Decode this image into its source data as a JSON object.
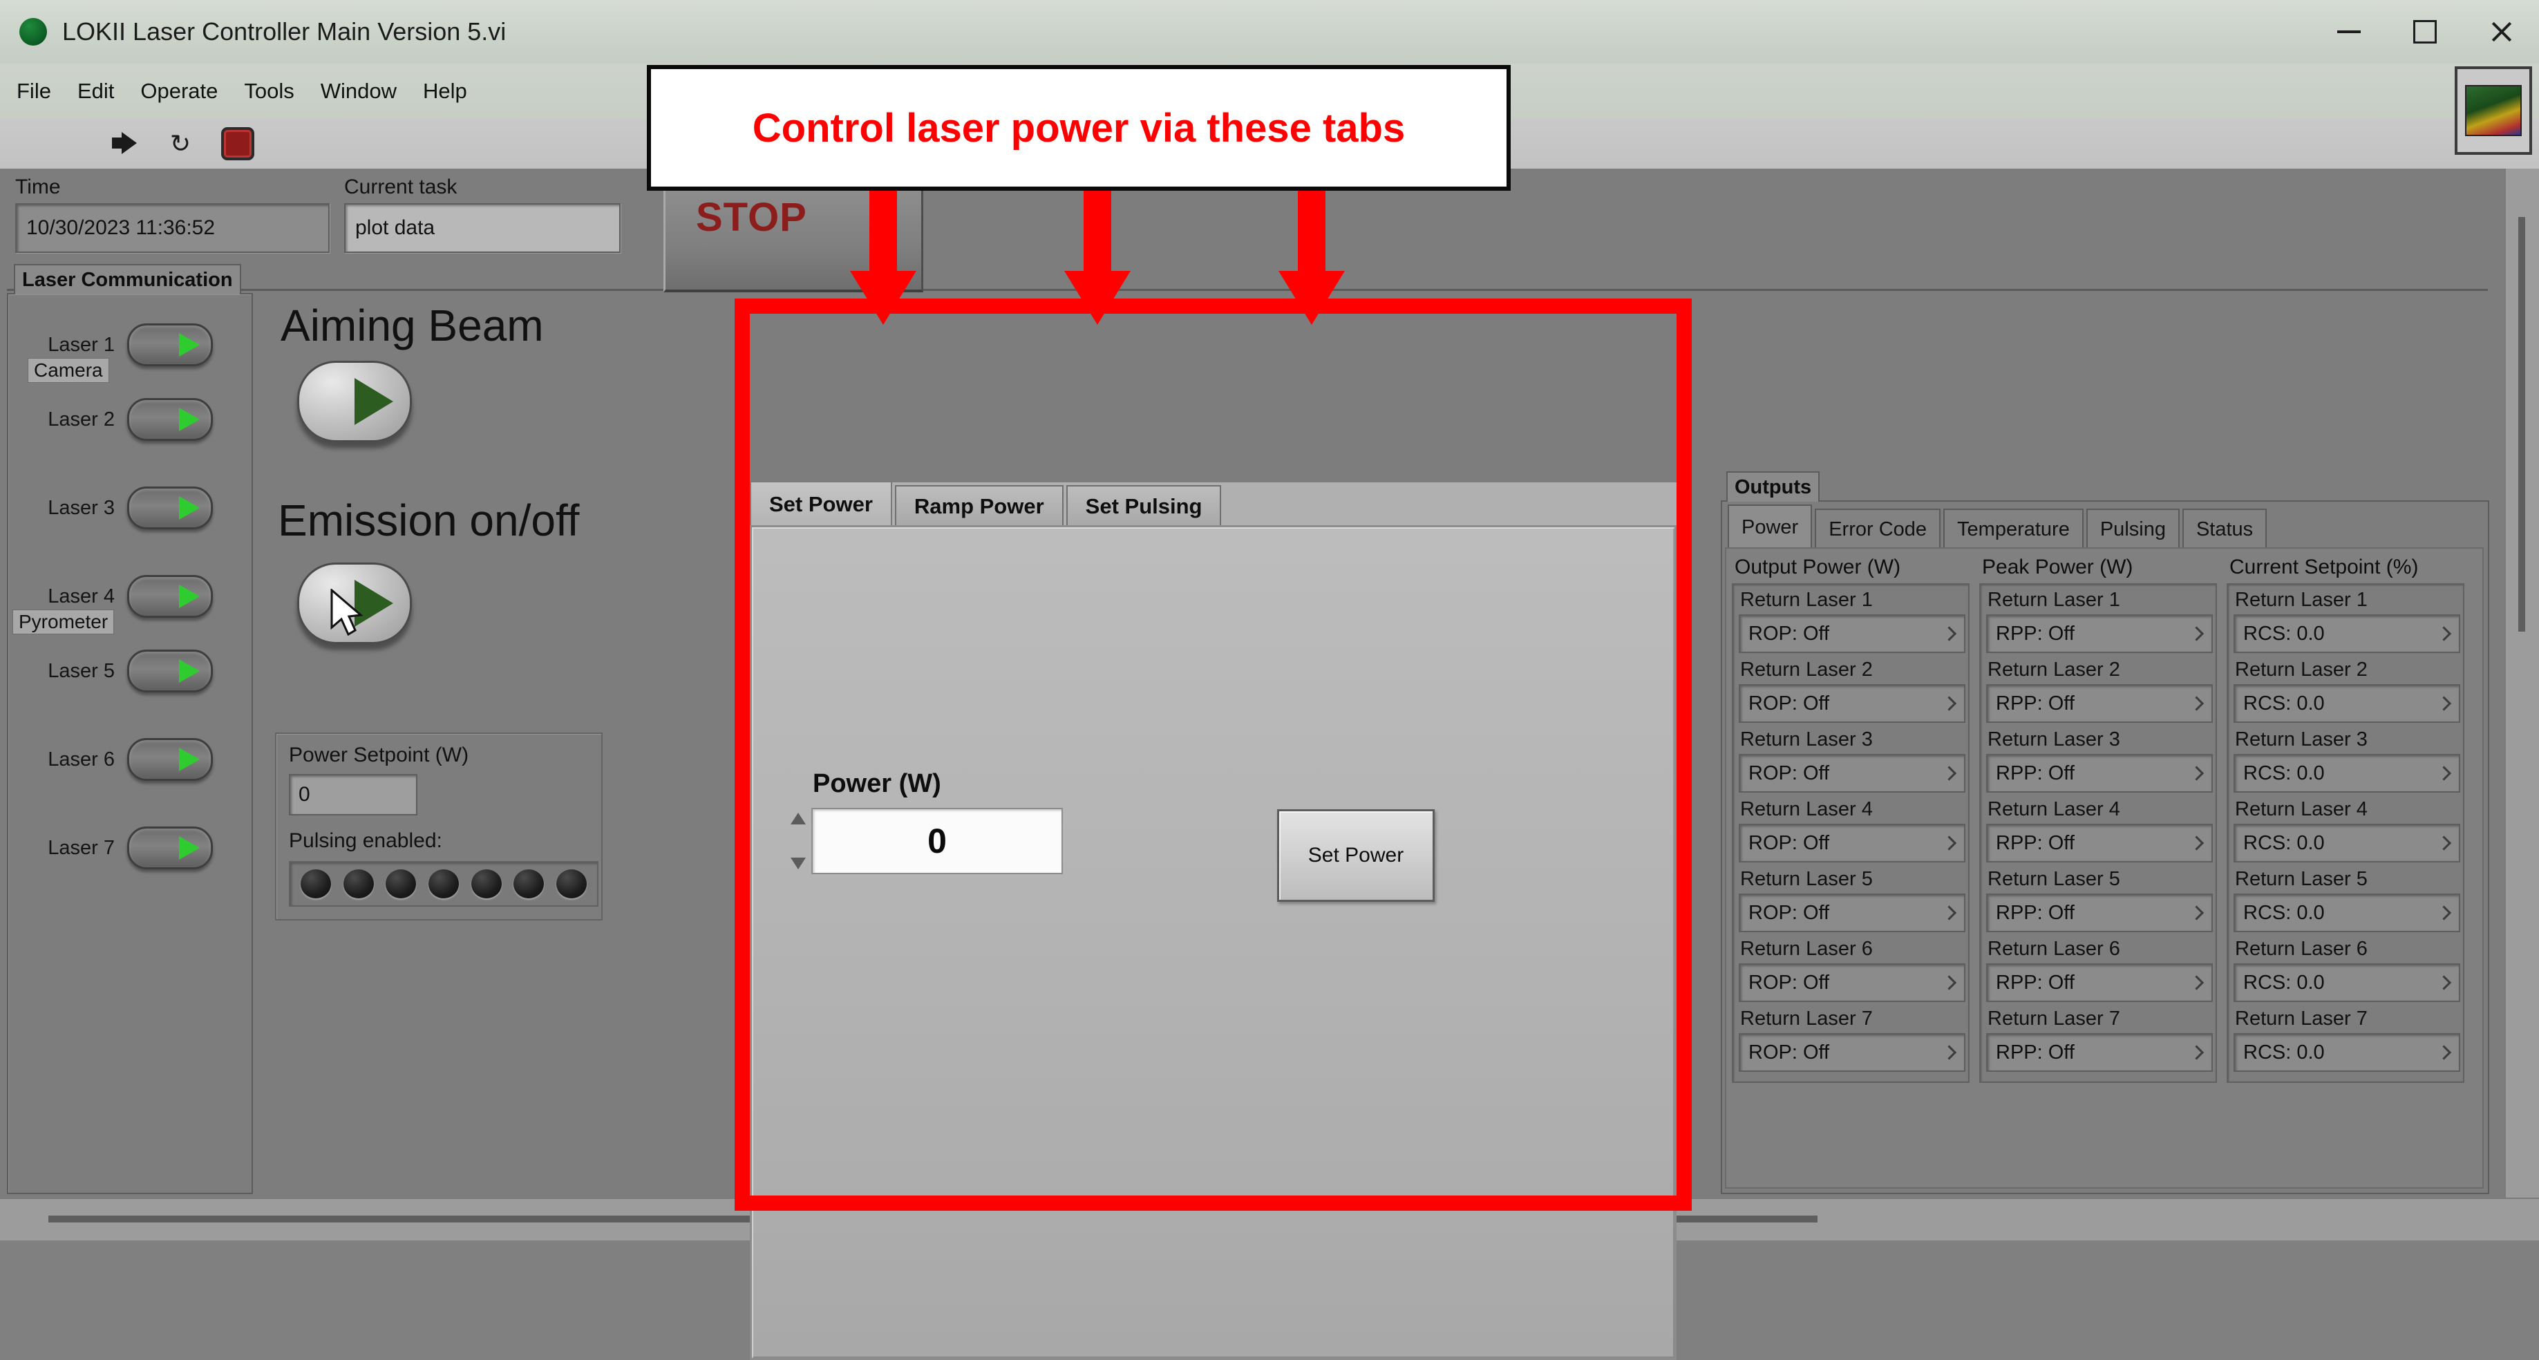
{
  "window": {
    "title": "LOKII Laser Controller Main Version 5.vi",
    "app_icon": "labview-vi-icon",
    "minimize": "minimize-icon",
    "maximize": "maximize-icon",
    "close": "close-icon"
  },
  "menubar": {
    "items": [
      "File",
      "Edit",
      "Operate",
      "Tools",
      "Window",
      "Help"
    ]
  },
  "toolbar": {
    "icons": [
      "run-arrow-icon",
      "run-continuously-icon",
      "abort-execution-icon"
    ],
    "loop_glyph": "↻"
  },
  "header": {
    "time_label": "Time",
    "time_value": "10/30/2023 11:36:52",
    "task_label": "Current task",
    "task_value": "plot data",
    "stop_label": "STOP"
  },
  "laser_communication": {
    "group_title": "Laser Communication",
    "lasers": [
      {
        "label": "Laser 1",
        "state": "on"
      },
      {
        "label": "Laser 2",
        "state": "on"
      },
      {
        "label": "Laser 3",
        "state": "on"
      },
      {
        "label": "Laser 4",
        "state": "on"
      },
      {
        "label": "Laser 5",
        "state": "on"
      },
      {
        "label": "Laser 6",
        "state": "on"
      },
      {
        "label": "Laser 7",
        "state": "on"
      }
    ],
    "sublabels": {
      "camera": "Camera",
      "pyrometer": "Pyrometer"
    }
  },
  "center_controls": {
    "aiming_beam_title": "Aiming Beam",
    "emission_title": "Emission on/off",
    "power_setpoint_label": "Power Setpoint (W)",
    "power_setpoint_value": "0",
    "pulsing_enabled_label": "Pulsing enabled:",
    "pulsing_led_count": 7,
    "pulsing_led_state": "off"
  },
  "annotation": {
    "text": "Control laser power via these tabs",
    "arrow_count": 3,
    "color": "#ff0000",
    "box_border": "#000000",
    "box_fill": "#ffffff"
  },
  "power_tabs": {
    "tabs": [
      "Set Power",
      "Ramp Power",
      "Set Pulsing"
    ],
    "active_tab": "Set Power",
    "power_label": "Power (W)",
    "power_value": "0",
    "set_power_button": "Set Power",
    "spinner_up": "increment-icon",
    "spinner_down": "decrement-icon"
  },
  "outputs": {
    "group_title": "Outputs",
    "tabs": [
      "Power",
      "Error Code",
      "Temperature",
      "Pulsing",
      "Status"
    ],
    "active_tab": "Power",
    "columns": [
      {
        "header": "Output Power (W)",
        "rows": [
          {
            "label": "Return Laser 1",
            "value": "ROP: Off"
          },
          {
            "label": "Return Laser 2",
            "value": "ROP: Off"
          },
          {
            "label": "Return Laser 3",
            "value": "ROP: Off"
          },
          {
            "label": "Return Laser 4",
            "value": "ROP: Off"
          },
          {
            "label": "Return Laser 5",
            "value": "ROP: Off"
          },
          {
            "label": "Return Laser 6",
            "value": "ROP: Off"
          },
          {
            "label": "Return Laser 7",
            "value": "ROP: Off"
          }
        ]
      },
      {
        "header": "Peak Power (W)",
        "rows": [
          {
            "label": "Return Laser 1",
            "value": "RPP: Off"
          },
          {
            "label": "Return Laser 2",
            "value": "RPP: Off"
          },
          {
            "label": "Return Laser 3",
            "value": "RPP: Off"
          },
          {
            "label": "Return Laser 4",
            "value": "RPP: Off"
          },
          {
            "label": "Return Laser 5",
            "value": "RPP: Off"
          },
          {
            "label": "Return Laser 6",
            "value": "RPP: Off"
          },
          {
            "label": "Return Laser 7",
            "value": "RPP: Off"
          }
        ]
      },
      {
        "header": "Current Setpoint (%)",
        "rows": [
          {
            "label": "Return Laser 1",
            "value": "RCS: 0.0"
          },
          {
            "label": "Return Laser 2",
            "value": "RCS: 0.0"
          },
          {
            "label": "Return Laser 3",
            "value": "RCS: 0.0"
          },
          {
            "label": "Return Laser 4",
            "value": "RCS: 0.0"
          },
          {
            "label": "Return Laser 5",
            "value": "RCS: 0.0"
          },
          {
            "label": "Return Laser 6",
            "value": "RCS: 0.0"
          },
          {
            "label": "Return Laser 7",
            "value": "RCS: 0.0"
          }
        ]
      }
    ]
  },
  "colors": {
    "panel_bg": "#7d7d7d",
    "tab_bg": "#b2b2b2",
    "accent_red": "#ff0000",
    "led_green": "#2ecc2e",
    "toggle_green": "#2c5c20",
    "titlebar": "#ccd3ca"
  }
}
